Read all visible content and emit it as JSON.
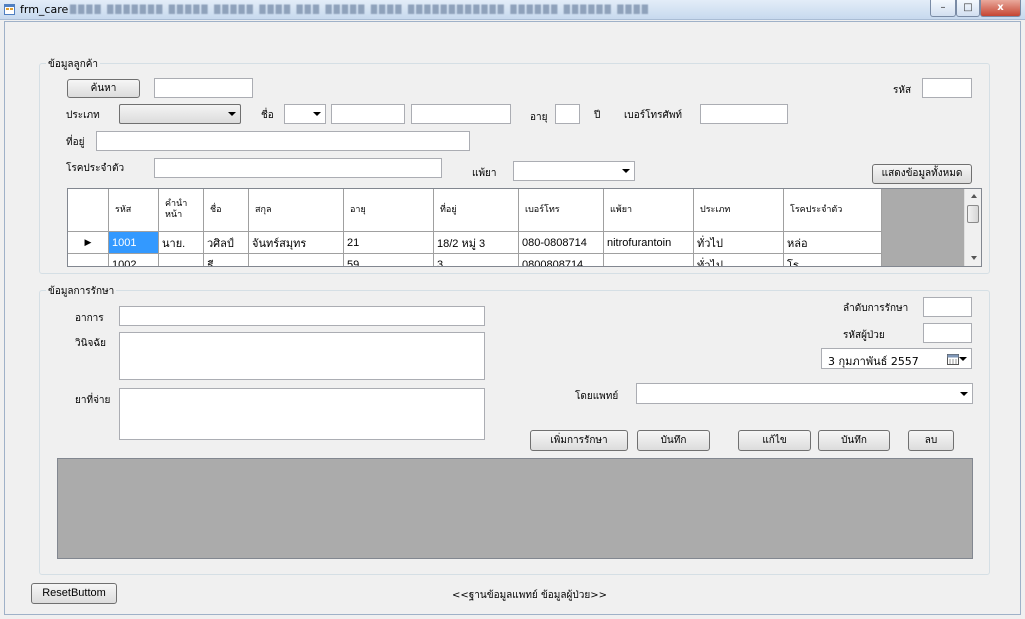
{
  "window": {
    "title": "frm_care",
    "minimize": "–",
    "maximize": "□",
    "close": "x"
  },
  "customer": {
    "group_label": "ข้อมูลลูกค้า",
    "search_button": "ค้นหา",
    "code_label": "รหัส",
    "type_label": "ประเภท",
    "name_label": "ชื่อ",
    "age_label": "อายุ",
    "year_label": "ปี",
    "phone_label": "เบอร์โทรศัพท์",
    "address_label": "ที่อยู่",
    "disease_label": "โรคประจำตัว",
    "allergy_label": "แพ้ยา",
    "show_all_button": "แสดงข้อมูลทั้งหมด"
  },
  "grid": {
    "columns": [
      "รหัส",
      "คำนำหน้า",
      "ชื่อ",
      "สกุล",
      "อายุ",
      "ที่อยู่",
      "เบอร์โทร",
      "แพ้ยา",
      "ประเภท",
      "โรคประจำตัว"
    ],
    "rows": [
      {
        "indicator": "▶",
        "cells": [
          "1001",
          "นาย.",
          "วศิลป์",
          "จันทร์สมุทร",
          "21",
          "18/2 หมู่ 3",
          "080-0808714",
          "nitrofurantoin",
          "ทั่วไป",
          "หล่อ"
        ]
      },
      {
        "indicator": "",
        "cells": [
          "1002",
          "",
          "ธี",
          "",
          "59",
          "3 ...",
          "0800808714",
          "...",
          "ทั่วไป",
          "โร"
        ]
      }
    ]
  },
  "treatment": {
    "group_label": "ข้อมูลการรักษา",
    "symptom_label": "อาการ",
    "diagnosis_label": "วินิจฉัย",
    "medicine_label": "ยาที่จ่าย",
    "order_label": "ลำดับการรักษา",
    "patient_code_label": "รหัสผู้ป่วย",
    "date_value": "3  กุมภาพันธ์  2557",
    "doctor_label": "โดยแพทย์",
    "add_treatment_button": "เพิ่มการรักษา",
    "save_button_1": "บันทึก",
    "edit_button": "แก้ไข",
    "save_button_2": "บันทึก",
    "delete_button": "ลบ"
  },
  "footer": {
    "reset_button": "ResetButtom",
    "nav_text": "<<ฐานข้อมูลแพทย์  ข้อมูลผู้ป่วย>>"
  },
  "icons": {
    "app": "form-icon",
    "calendar": "calendar-icon",
    "row_indicator": "row-pointer-icon"
  },
  "colors": {
    "selection": "#3399ff",
    "grid_background": "#ababab"
  }
}
